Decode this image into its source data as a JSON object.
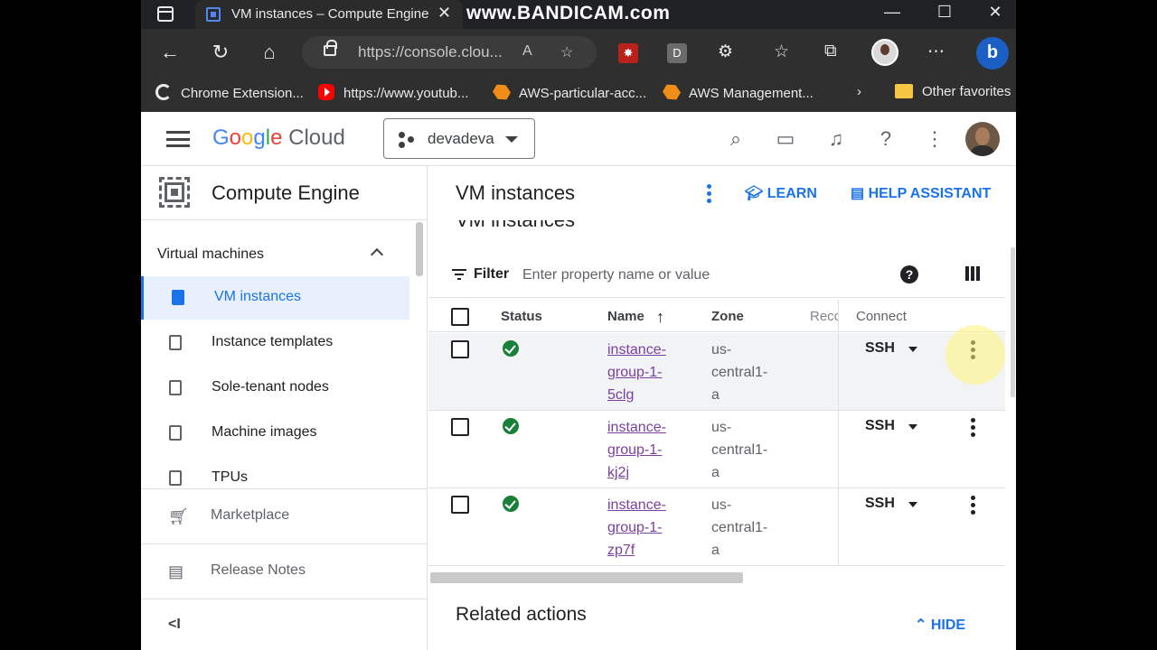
{
  "browser": {
    "tab_title": "VM instances – Compute Engine",
    "tab_close": "✕",
    "watermark": "www.BANDICAM.com",
    "url": "https://console.clou...",
    "bookmarks": [
      {
        "label": "Chrome Extension...",
        "icon": "google-icon"
      },
      {
        "label": "https://www.youtub...",
        "icon": "youtube-icon"
      },
      {
        "label": "AWS-particular-acc...",
        "icon": "aws-icon"
      },
      {
        "label": "AWS Management...",
        "icon": "aws-icon"
      },
      {
        "label": "Other favorites",
        "icon": "folder-icon"
      }
    ],
    "extension_d": "D"
  },
  "header": {
    "logo_google": "Google",
    "logo_cloud": "Cloud",
    "project_name": "devadeva"
  },
  "sidebar": {
    "product_title": "Compute Engine",
    "section_label": "Virtual machines",
    "items": [
      {
        "label": "VM instances",
        "active": true
      },
      {
        "label": "Instance templates",
        "active": false
      },
      {
        "label": "Sole-tenant nodes",
        "active": false
      },
      {
        "label": "Machine images",
        "active": false
      },
      {
        "label": "TPUs",
        "active": false
      }
    ],
    "marketplace": "Marketplace",
    "release_notes": "Release Notes",
    "collapse_glyph": "<I"
  },
  "main": {
    "title": "VM instances",
    "learn_label": "LEARN",
    "help_label": "HELP ASSISTANT",
    "subtitle": "VM instances",
    "filter_label": "Filter",
    "filter_placeholder": "Enter property name or value",
    "columns": {
      "status": "Status",
      "name": "Name",
      "zone": "Zone",
      "recommendation": "Reco",
      "connect": "Connect"
    },
    "rows": [
      {
        "name": "instance-group-1-5clg",
        "name_lines": [
          "instance-",
          "group-1-",
          "5clg"
        ],
        "zone_lines": [
          "us-",
          "central1-",
          "a"
        ],
        "connect": "SSH",
        "status": "running"
      },
      {
        "name": "instance-group-1-kj2j",
        "name_lines": [
          "instance-",
          "group-1-",
          "kj2j"
        ],
        "zone_lines": [
          "us-",
          "central1-",
          "a"
        ],
        "connect": "SSH",
        "status": "running"
      },
      {
        "name": "instance-group-1-zp7f",
        "name_lines": [
          "instance-",
          "group-1-",
          "zp7f"
        ],
        "zone_lines": [
          "us-",
          "central1-",
          "a"
        ],
        "connect": "SSH",
        "status": "running"
      }
    ],
    "related_actions": "Related actions",
    "hide_label": "HIDE"
  },
  "colors": {
    "accent": "#1a73e8",
    "status_ok": "#188038",
    "link": "#7b3fa0"
  }
}
